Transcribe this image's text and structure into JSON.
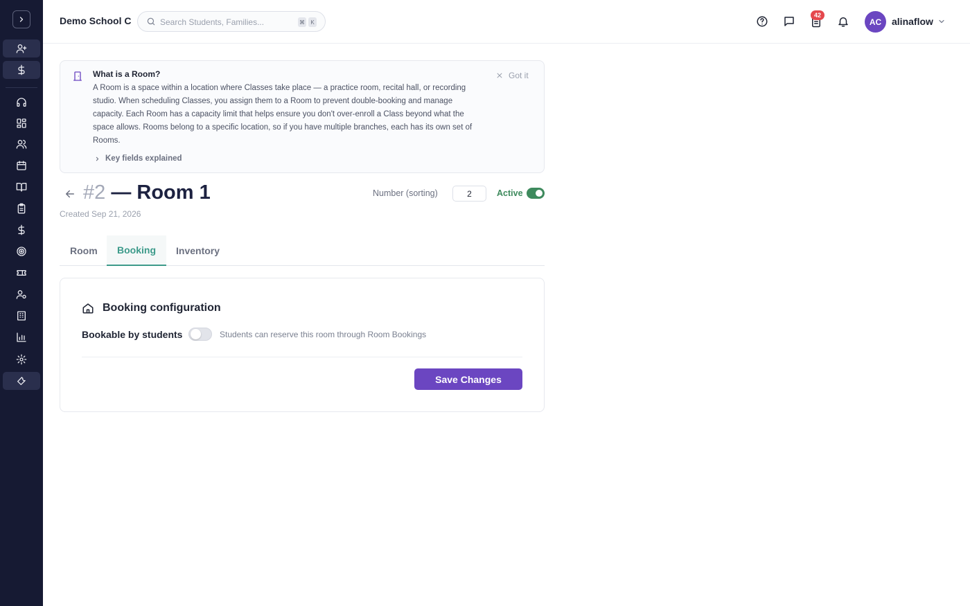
{
  "header": {
    "school_name": "Demo School C",
    "search_placeholder": "Search Students, Families...",
    "shortcut_keys": [
      "⌘",
      "K"
    ],
    "notification_count": "42",
    "user_initials": "AC",
    "username": "alinaflow",
    "icons": [
      "help-circle-icon",
      "message-icon",
      "clipboard-icon",
      "bell-icon",
      "chevron-down-icon"
    ]
  },
  "sidebar": {
    "items": [
      {
        "icon": "user-plus-icon",
        "highlighted": true
      },
      {
        "icon": "dollar-icon",
        "highlighted": true
      },
      {
        "icon": "headset-icon",
        "highlighted": false
      },
      {
        "icon": "grid-icon",
        "highlighted": false
      },
      {
        "icon": "users-icon",
        "highlighted": false
      },
      {
        "icon": "calendar-icon",
        "highlighted": false
      },
      {
        "icon": "book-icon",
        "highlighted": false
      },
      {
        "icon": "clipboard-icon",
        "highlighted": false
      },
      {
        "icon": "dollar-icon",
        "highlighted": false
      },
      {
        "icon": "target-icon",
        "highlighted": false
      },
      {
        "icon": "ticket-icon",
        "highlighted": false
      },
      {
        "icon": "user-settings-icon",
        "highlighted": false
      },
      {
        "icon": "building-icon",
        "highlighted": false
      },
      {
        "icon": "bar-chart-icon",
        "highlighted": false
      },
      {
        "icon": "gear-icon",
        "highlighted": false
      },
      {
        "icon": "wrench-icon",
        "highlighted": true
      }
    ]
  },
  "info": {
    "title": "What is a Room?",
    "body": "A Room is a space within a location where Classes take place — a practice room, recital hall, or recording studio. When scheduling Classes, you assign them to a Room to prevent double-booking and manage capacity. Each Room has a capacity limit that helps ensure you don't over-enroll a Class beyond what the space allows. Rooms belong to a specific location, so if you have multiple branches, each has its own set of Rooms.",
    "dismiss_label": "Got it",
    "key_fields_label": "Key fields explained"
  },
  "room": {
    "number": "#2",
    "name": "— Room 1",
    "created": "Created Sep 21, 2026",
    "number_label": "Number (sorting)",
    "number_value": "2",
    "active_label": "Active",
    "active": true
  },
  "tabs": [
    {
      "label": "Room",
      "active": false
    },
    {
      "label": "Booking",
      "active": true
    },
    {
      "label": "Inventory",
      "active": false
    }
  ],
  "booking": {
    "title": "Booking configuration",
    "bookable_label": "Bookable by students",
    "bookable": false,
    "bookable_desc": "Students can reserve this room through Room Bookings",
    "save_label": "Save Changes"
  },
  "colors": {
    "sidebar_bg": "#161a33",
    "accent_purple": "#6b46c1",
    "active_green": "#3e8a5d",
    "tab_teal": "#3c9a8a",
    "badge_red": "#e5484d"
  }
}
